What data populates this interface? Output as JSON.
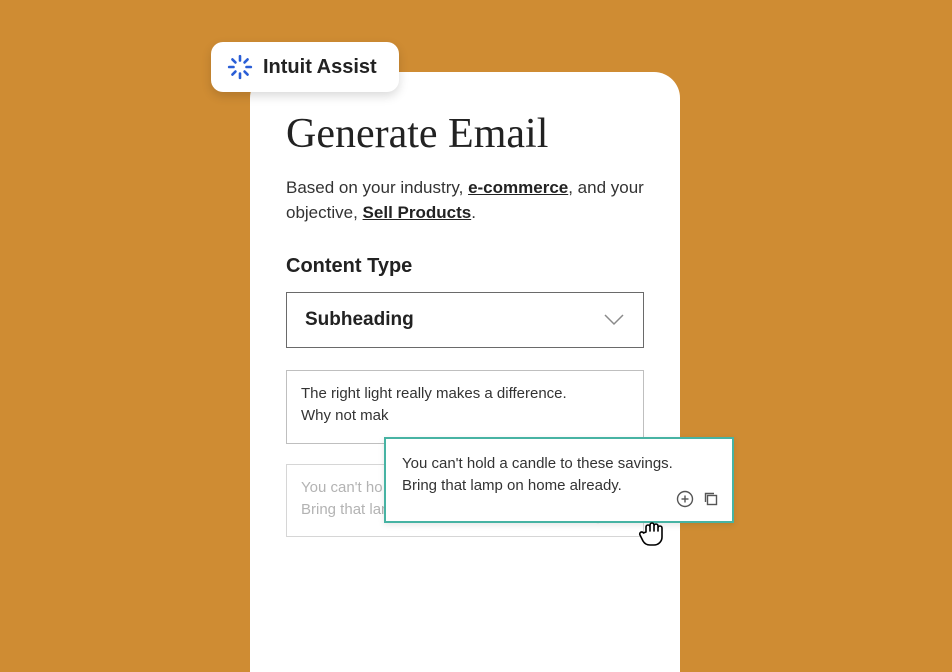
{
  "assist": {
    "label": "Intuit Assist"
  },
  "panel": {
    "title": "Generate Email",
    "sub_pre": "Based on your industry, ",
    "industry": "e-commerce",
    "sub_mid": ", and your objective, ",
    "objective": "Sell Products",
    "sub_post": ".",
    "section_label": "Content Type",
    "select_value": "Subheading",
    "card1_line1": "The right light really makes a difference.",
    "card1_line2": "Why not mak",
    "card2_line1": "You can't ho",
    "card2_line2": "Bring that lamp on home already."
  },
  "float": {
    "line1": "You can't hold a candle to these savings.",
    "line2": "Bring that lamp on home already."
  }
}
